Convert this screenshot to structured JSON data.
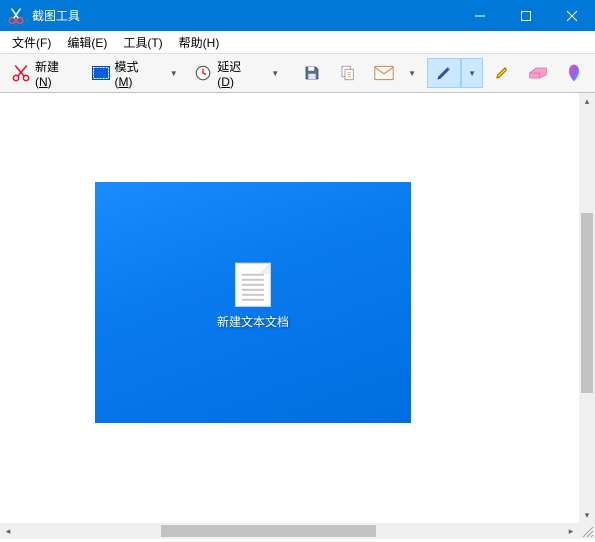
{
  "titlebar": {
    "title": "截图工具"
  },
  "menubar": {
    "file": "文件(F)",
    "edit": "编辑(E)",
    "tools": "工具(T)",
    "help": "帮助(H)"
  },
  "toolbar": {
    "new_label_pre": "新建(",
    "new_label_key": "N",
    "new_label_post": ")",
    "mode_label_pre": "模式(",
    "mode_label_key": "M",
    "mode_label_post": ")",
    "delay_label_pre": "延迟(",
    "delay_label_key": "D",
    "delay_label_post": ")"
  },
  "screenshot": {
    "file_label": "新建文本文档"
  }
}
